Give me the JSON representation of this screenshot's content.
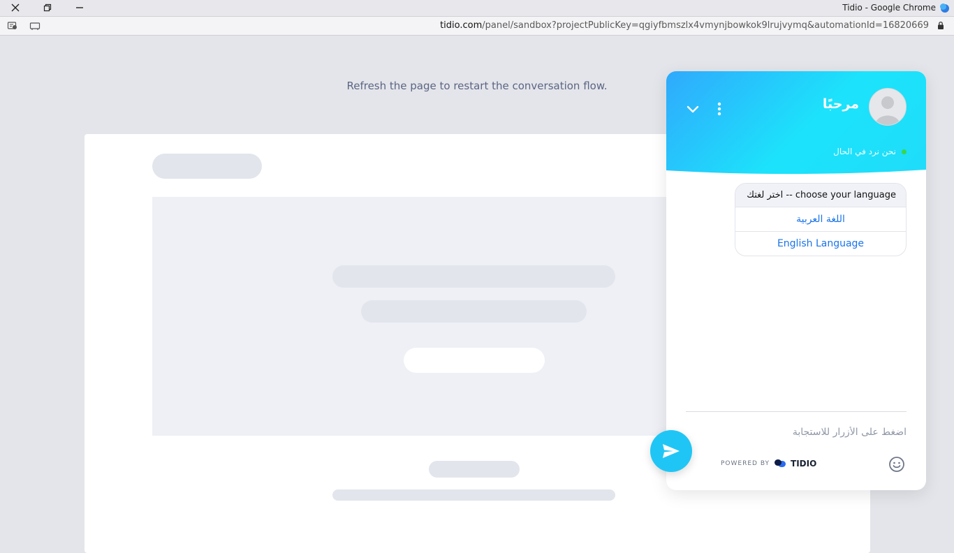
{
  "window": {
    "title": "Tidio - Google Chrome"
  },
  "address_bar": {
    "domain": "tidio.com",
    "path": "/panel/sandbox?projectPublicKey=qgiyfbmszlx4vmynjbowkok9lrujvymq&automationId=16820669"
  },
  "page": {
    "refresh_message": "Refresh the page to restart the conversation flow."
  },
  "widget": {
    "greeting": "مرحبًا",
    "status_text": "نحن نرد في الحال",
    "status_color": "#3ad54b",
    "header_gradient": [
      "#30a9fc",
      "#1ce3fb"
    ],
    "message": {
      "question": "اختر لغتك -- choose your language",
      "options": [
        {
          "label": "اللغة العربية"
        },
        {
          "label": "English Language"
        }
      ]
    },
    "input_placeholder": "اضغط على الأزرار للاستجابة",
    "powered_by_label": "POWERED BY",
    "brand": "TIDIO",
    "accent_color": "#1fc6f5",
    "link_color": "#1a74e8"
  }
}
